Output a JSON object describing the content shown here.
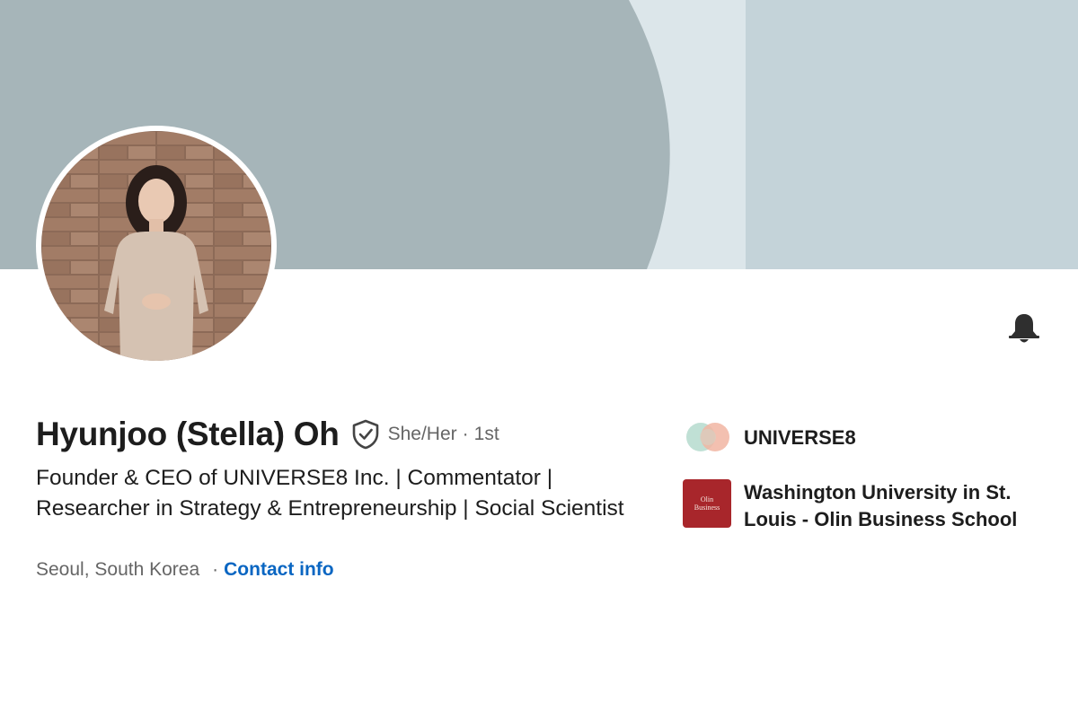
{
  "profile": {
    "name": "Hyunjoo (Stella) Oh",
    "pronouns": "She/Her",
    "degree_separator": "·",
    "connection_degree": "1st",
    "headline": "Founder & CEO of UNIVERSE8 Inc. | Commentator | Researcher in Strategy & Entrepreneurship | Social Scientist",
    "location": "Seoul, South Korea",
    "location_separator": "·",
    "contact_info_label": "Contact info"
  },
  "organizations": [
    {
      "name": "UNIVERSE8",
      "logo_icon": "universe8-logo"
    },
    {
      "name": "Washington University in St. Louis - Olin Business School",
      "logo_icon": "olin-business-logo",
      "logo_text_line1": "Olin",
      "logo_text_line2": "Business"
    }
  ],
  "icons": {
    "verified": "shield-check-icon",
    "notifications": "bell-icon"
  },
  "colors": {
    "banner_primary": "#a6b5b9",
    "banner_secondary": "#c4d3d9",
    "banner_light": "#dce6ea",
    "link": "#0a66c2",
    "olin_red": "#a8262b"
  }
}
